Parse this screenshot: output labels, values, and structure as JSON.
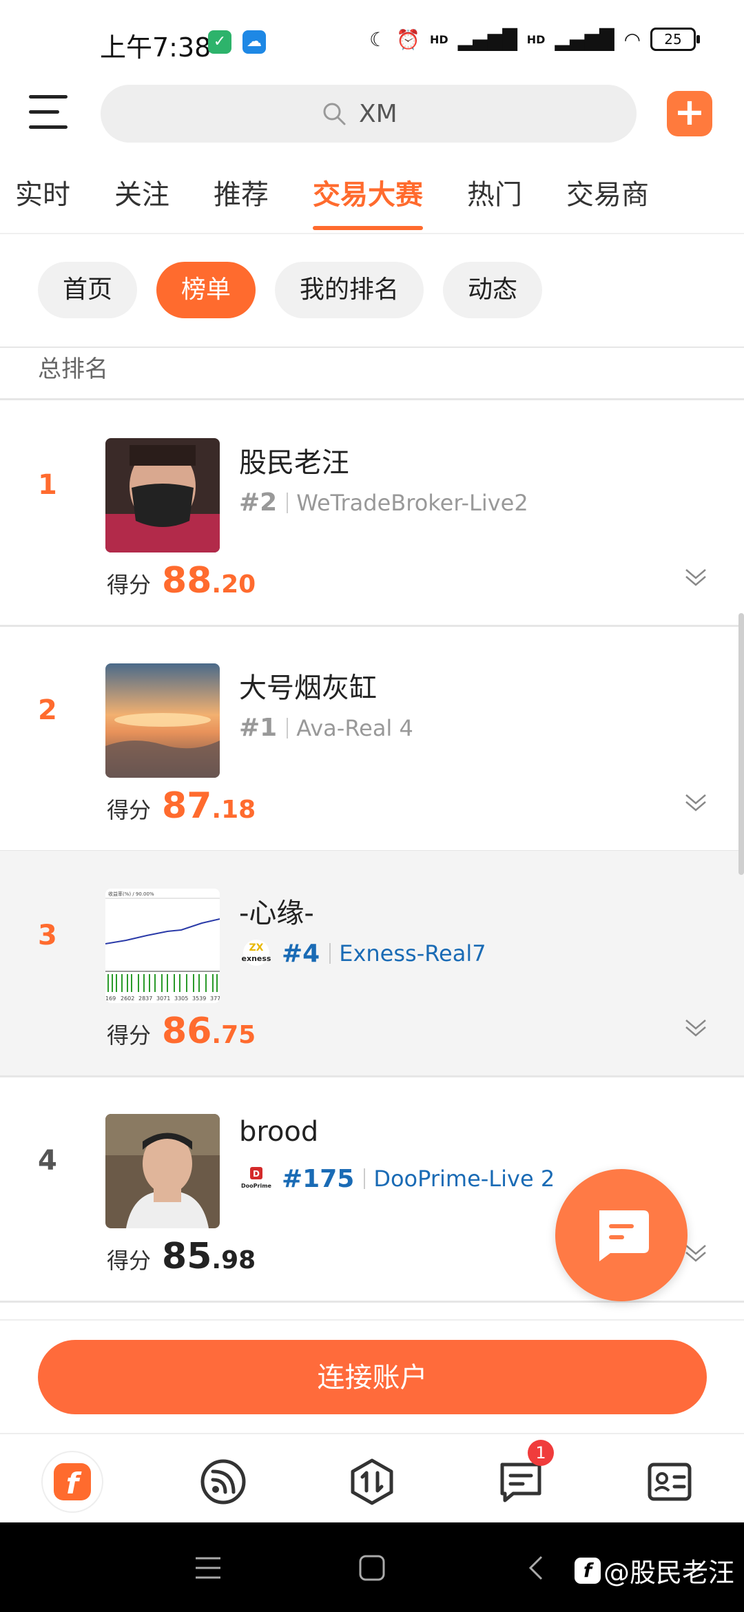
{
  "status_bar": {
    "time": "上午7:38",
    "hd1": "HD",
    "hd2": "HD",
    "battery": "25"
  },
  "search": {
    "value": "XM"
  },
  "tabs": [
    {
      "label": "实时"
    },
    {
      "label": "关注"
    },
    {
      "label": "推荐"
    },
    {
      "label": "交易大赛",
      "active": true
    },
    {
      "label": "热门"
    },
    {
      "label": "交易商"
    }
  ],
  "subtabs": [
    {
      "label": "首页"
    },
    {
      "label": "榜单",
      "active": true
    },
    {
      "label": "我的排名"
    },
    {
      "label": "动态"
    }
  ],
  "section_title": "总排名",
  "score_label": "得分",
  "rankings": [
    {
      "rank": "1",
      "name": "股民老汪",
      "broker_rank": "#2",
      "broker": "WeTradeBroker-Live2",
      "score_int": "88",
      "score_dec": ".20",
      "score_color": "#ff6b2e",
      "broker_color": "#999999",
      "rank_num_color": "#999999",
      "highlight": false
    },
    {
      "rank": "2",
      "name": "大号烟灰缸",
      "broker_rank": "#1",
      "broker": "Ava-Real 4",
      "score_int": "87",
      "score_dec": ".18",
      "score_color": "#ff6b2e",
      "broker_color": "#999999",
      "rank_num_color": "#999999",
      "highlight": false
    },
    {
      "rank": "3",
      "name": "-心缘-",
      "broker_rank": "#4",
      "broker": "Exness-Real7",
      "broker_logo": "exness",
      "score_int": "86",
      "score_dec": ".75",
      "score_color": "#ff6b2e",
      "broker_color": "#1a6bb5",
      "rank_num_color": "#1a6bb5",
      "highlight": true,
      "chart_text": "收益率(%) / 90.00%",
      "chart_ticks": [
        "169",
        "2602",
        "2837",
        "3071",
        "3305",
        "3539",
        "377"
      ]
    },
    {
      "rank": "4",
      "name": "brood",
      "broker_rank": "#175",
      "broker": "DooPrime-Live 2",
      "broker_logo": "DooPrime",
      "score_int": "85",
      "score_dec": ".98",
      "score_color": "#222222",
      "broker_color": "#1a6bb5",
      "rank_num_color": "#1a6bb5",
      "highlight": false
    }
  ],
  "colors": {
    "accent": "#ff6b2e",
    "rank_top": "#ff6b2e",
    "rank_other": "#555555"
  },
  "connect_button": "连接账户",
  "bottom_nav": {
    "badge_count": "1"
  },
  "watermark": "@股民老汪"
}
